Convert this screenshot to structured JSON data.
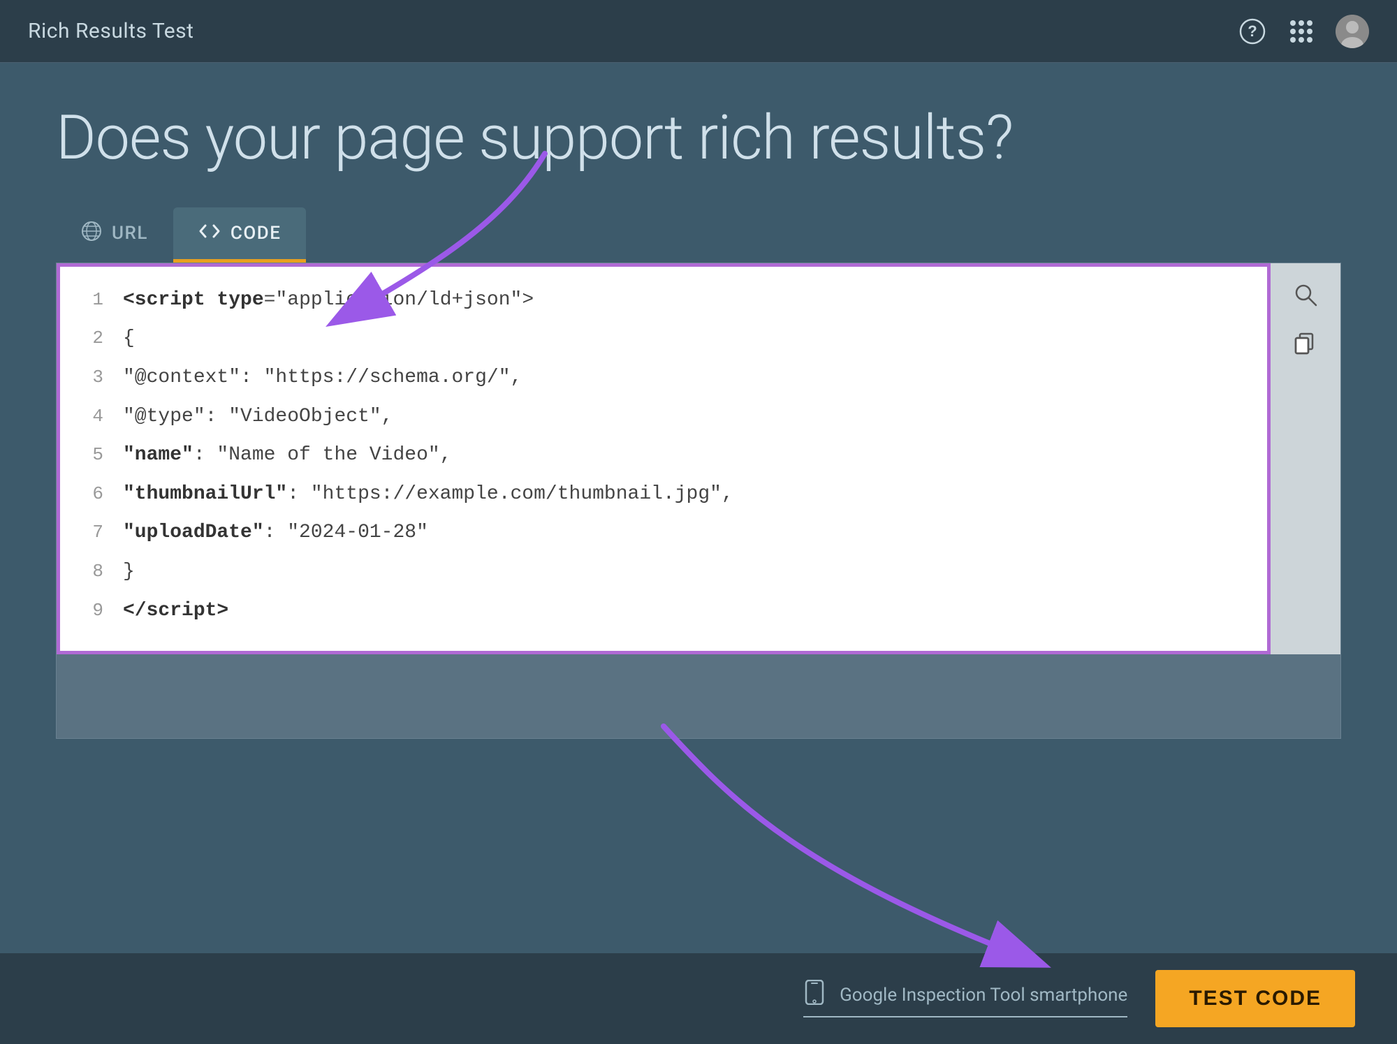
{
  "topbar": {
    "title": "Rich Results Test",
    "help_icon": "?",
    "grid_icon": "grid",
    "avatar_icon": "user-avatar"
  },
  "headline": "Does your page support rich results?",
  "tabs": [
    {
      "id": "url",
      "label": "URL",
      "icon": "globe",
      "active": false
    },
    {
      "id": "code",
      "label": "CODE",
      "icon": "code-brackets",
      "active": true
    }
  ],
  "code_editor": {
    "lines": [
      {
        "num": "1",
        "content_html": "<span class='attr-name'>&lt;script</span> <span class='attr-name'>type</span>=\"application/ld+json\"&gt;"
      },
      {
        "num": "2",
        "content_html": "{"
      },
      {
        "num": "3",
        "content_html": "\"@context\": \"https://schema.org/\","
      },
      {
        "num": "4",
        "content_html": "\"@type\": \"VideoObject\","
      },
      {
        "num": "5",
        "content_html": "<span class='key-bold'>\"name\"</span>: \"Name of the Video\","
      },
      {
        "num": "6",
        "content_html": "<span class='key-bold'>\"thumbnailUrl\"</span>: \"https://example.com/thumbnail.jpg\","
      },
      {
        "num": "7",
        "content_html": "<span class='key-bold'>\"uploadDate\"</span>: \"2024-01-28\""
      },
      {
        "num": "8",
        "content_html": "}"
      },
      {
        "num": "9",
        "content_html": "<span class='attr-name'>&lt;/script&gt;</span>"
      }
    ]
  },
  "bottom": {
    "device_icon": "smartphone",
    "device_label": "Google Inspection Tool smartphone",
    "test_button_label": "TEST CODE"
  }
}
